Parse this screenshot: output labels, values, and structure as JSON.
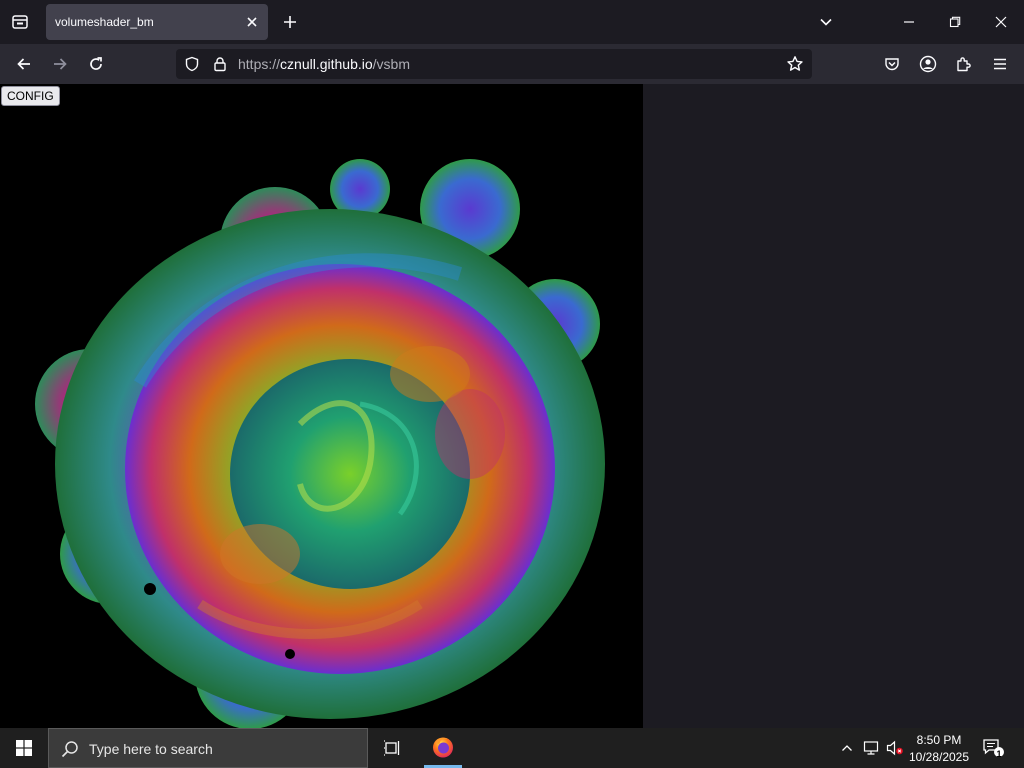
{
  "browser": {
    "tab": {
      "title": "volumeshader_bm"
    },
    "url": {
      "scheme": "https://",
      "host": "cznull.github.io",
      "path": "/vsbm"
    }
  },
  "page": {
    "config_label": "CONFIG"
  },
  "taskbar": {
    "search_placeholder": "Type here to search",
    "time": "8:50 PM",
    "date": "10/28/2025",
    "notification_count": "1"
  },
  "colors": {
    "tab_strip": "#1c1b22",
    "active_tab": "#42414d",
    "toolbar": "#2b2a33",
    "urlbar": "#1c1b22",
    "taskbar": "#1f1f1f",
    "accent": "#76b9ed"
  }
}
